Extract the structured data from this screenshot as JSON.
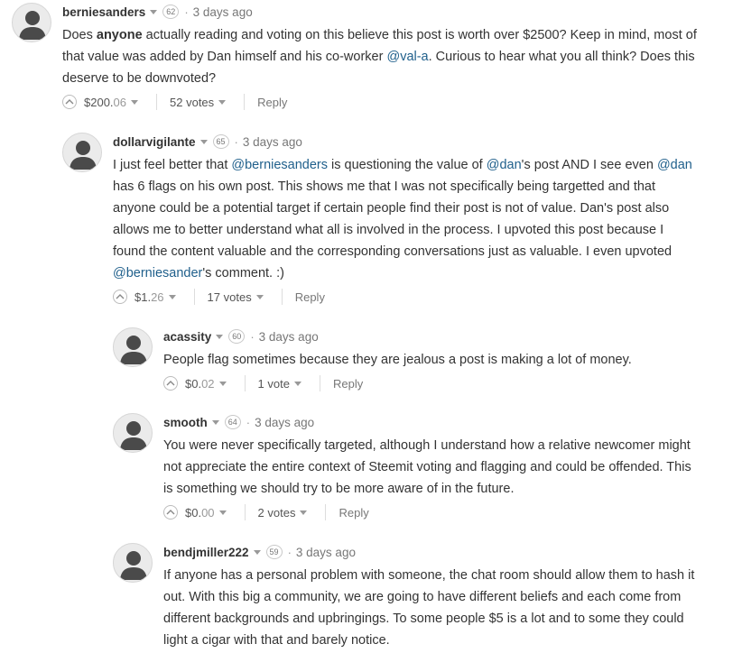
{
  "comments": [
    {
      "author": "berniesanders",
      "reputation": "62",
      "time": "3 days ago",
      "text": {
        "p1": "Does ",
        "bold": "anyone",
        "p2": " actually reading and voting on this believe this post is worth over $2500? Keep in mind, most of that value was added by Dan himself and his co-worker ",
        "mention": "@val-a",
        "p3": ". Curious to hear what you all think? Does this deserve to be downvoted?"
      },
      "payout_main": "$200.",
      "payout_cents": "06",
      "votes": "52 votes",
      "reply": "Reply"
    },
    {
      "author": "dollarvigilante",
      "reputation": "65",
      "time": "3 days ago",
      "text": {
        "p1": "I just feel better that ",
        "m1": "@berniesanders",
        "p2": " is questioning the value of ",
        "m2": "@dan",
        "p3": "'s post AND I see even ",
        "m3": "@dan",
        "p4": " has 6 flags on his own post. This shows me that I was not specifically being targetted and that anyone could be a potential target if certain people find their post is not of value. Dan's post also allows me to better understand what all is involved in the process. I upvoted this post because I found the content valuable and the corresponding conversations just as valuable. I even upvoted ",
        "m4": "@berniesander",
        "p5": "'s comment. :)"
      },
      "payout_main": "$1.",
      "payout_cents": "26",
      "votes": "17 votes",
      "reply": "Reply"
    },
    {
      "author": "acassity",
      "reputation": "60",
      "time": "3 days ago",
      "text": "People flag sometimes because they are jealous a post is making a lot of money.",
      "payout_main": "$0.",
      "payout_cents": "02",
      "votes": "1 vote",
      "reply": "Reply"
    },
    {
      "author": "smooth",
      "reputation": "64",
      "time": "3 days ago",
      "text": "You were never specifically targeted, although I understand how a relative newcomer might not appreciate the entire context of Steemit voting and flagging and could be offended. This is something we should try to be more aware of in the future.",
      "payout_main": "$0.",
      "payout_cents": "00",
      "votes": "2 votes",
      "reply": "Reply"
    },
    {
      "author": "bendjmiller222",
      "reputation": "59",
      "time": "3 days ago",
      "text": "If anyone has a personal problem with someone, the chat room should allow them to hash it out. With this big a community, we are going to have different beliefs and each come from different backgrounds and upbringings. To some people $5 is a lot and to some they could light a cigar with that and barely notice."
    }
  ],
  "colors": {
    "mention": "#1f5f8b",
    "text": "#333333",
    "muted": "#777777"
  },
  "icons": {
    "avatar": "user-silhouette-icon",
    "upvote": "chevron-up-icon",
    "dropdown": "caret-down-icon"
  }
}
